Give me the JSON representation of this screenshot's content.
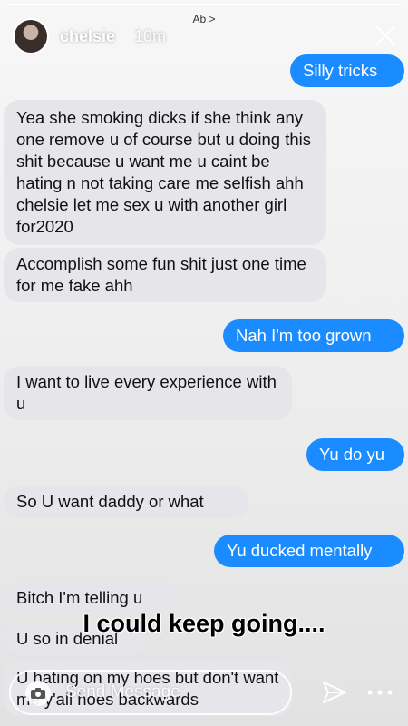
{
  "story": {
    "progress": 1.0
  },
  "header": {
    "contact": "Ab >",
    "username": "chelsie",
    "timestamp": "10m"
  },
  "messages": [
    {
      "sender": "me",
      "text": "Silly tricks"
    },
    {
      "sender": "them",
      "text": "Yea she smoking dicks if she think any one remove u of course but u doing this shit because u want me u caint be hating n not taking care me selfish ahh chelsie let me sex u with another girl for2020"
    },
    {
      "sender": "them",
      "text": "Accomplish some fun shit just one time for me fake ahh"
    },
    {
      "sender": "me",
      "text": "Nah I'm too grown"
    },
    {
      "sender": "them",
      "text": "I want to live every experience with u"
    },
    {
      "sender": "me",
      "text": "Yu do yu"
    },
    {
      "sender": "them",
      "text": "So U want daddy or what"
    },
    {
      "sender": "me",
      "text": "Yu ducked mentally"
    },
    {
      "sender": "them",
      "text": "Bitch I'm telling u"
    },
    {
      "sender": "them",
      "text": "U so in denial"
    },
    {
      "sender": "them",
      "text": "U hating on my hoes but don't want me y'all hoes backwards"
    }
  ],
  "overlay": {
    "caption": "I could keep going...."
  },
  "reply": {
    "placeholder": "Send Message"
  },
  "icons": {
    "camera": "camera-icon",
    "send": "send-icon",
    "close": "close-icon",
    "more": "more-icon"
  }
}
